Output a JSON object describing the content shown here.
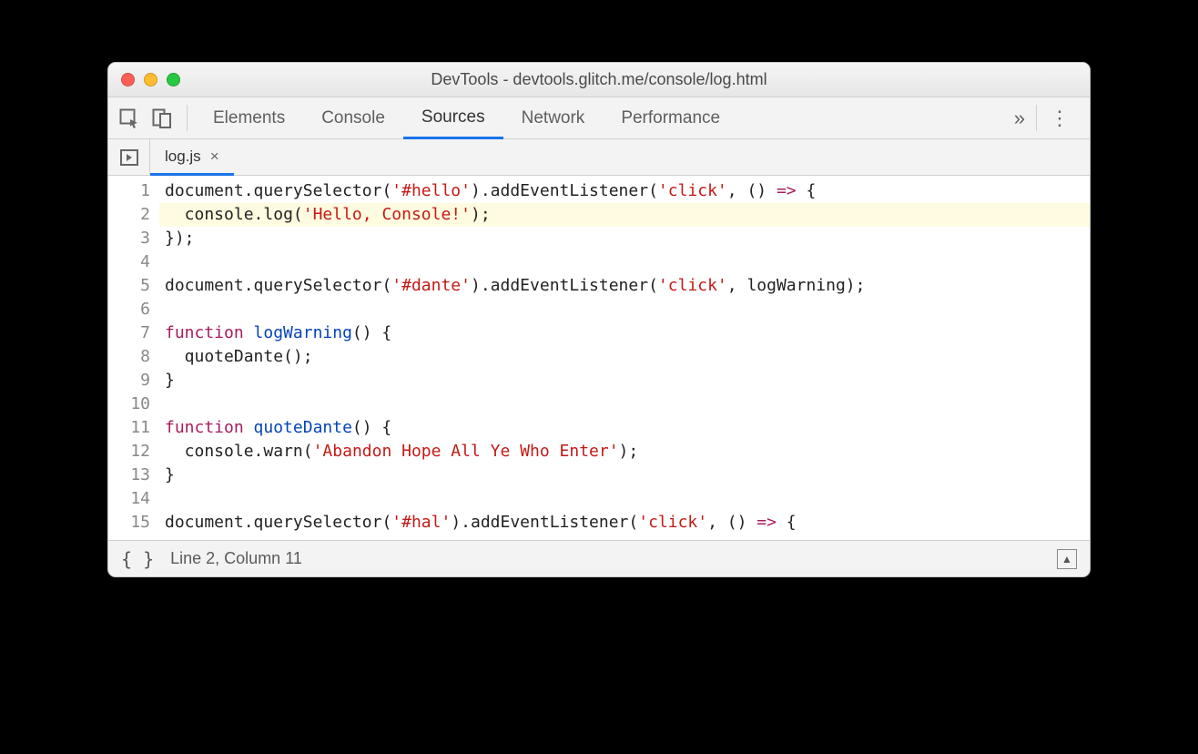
{
  "window": {
    "title": "DevTools - devtools.glitch.me/console/log.html"
  },
  "mainTabs": {
    "items": [
      {
        "label": "Elements",
        "active": false
      },
      {
        "label": "Console",
        "active": false
      },
      {
        "label": "Sources",
        "active": true
      },
      {
        "label": "Network",
        "active": false
      },
      {
        "label": "Performance",
        "active": false
      }
    ],
    "expand_glyph": "»"
  },
  "fileTabs": {
    "items": [
      {
        "label": "log.js",
        "close_glyph": "×"
      }
    ]
  },
  "code": {
    "lines": [
      {
        "n": 1,
        "hl": false,
        "segs": [
          [
            "d",
            "document"
          ],
          [
            "op",
            "."
          ],
          [
            "d",
            "querySelector"
          ],
          [
            "op",
            "("
          ],
          [
            "s",
            "'#hello'"
          ],
          [
            "op",
            ")."
          ],
          [
            "d",
            "addEventListener"
          ],
          [
            "op",
            "("
          ],
          [
            "s",
            "'click'"
          ],
          [
            "op",
            ", () "
          ],
          [
            "k",
            "=>"
          ],
          [
            "op",
            " {"
          ]
        ]
      },
      {
        "n": 2,
        "hl": true,
        "segs": [
          [
            "op",
            "  console"
          ],
          [
            "op",
            "."
          ],
          [
            "d",
            "log"
          ],
          [
            "op",
            "("
          ],
          [
            "s",
            "'Hello, Console!'"
          ],
          [
            "op",
            ");"
          ]
        ]
      },
      {
        "n": 3,
        "hl": false,
        "segs": [
          [
            "op",
            "});"
          ]
        ]
      },
      {
        "n": 4,
        "hl": false,
        "segs": []
      },
      {
        "n": 5,
        "hl": false,
        "segs": [
          [
            "d",
            "document"
          ],
          [
            "op",
            "."
          ],
          [
            "d",
            "querySelector"
          ],
          [
            "op",
            "("
          ],
          [
            "s",
            "'#dante'"
          ],
          [
            "op",
            ")."
          ],
          [
            "d",
            "addEventListener"
          ],
          [
            "op",
            "("
          ],
          [
            "s",
            "'click'"
          ],
          [
            "op",
            ", logWarning);"
          ]
        ]
      },
      {
        "n": 6,
        "hl": false,
        "segs": []
      },
      {
        "n": 7,
        "hl": false,
        "segs": [
          [
            "k",
            "function "
          ],
          [
            "fn",
            "logWarning"
          ],
          [
            "op",
            "() {"
          ]
        ]
      },
      {
        "n": 8,
        "hl": false,
        "segs": [
          [
            "op",
            "  quoteDante();"
          ]
        ]
      },
      {
        "n": 9,
        "hl": false,
        "segs": [
          [
            "op",
            "}"
          ]
        ]
      },
      {
        "n": 10,
        "hl": false,
        "segs": []
      },
      {
        "n": 11,
        "hl": false,
        "segs": [
          [
            "k",
            "function "
          ],
          [
            "fn",
            "quoteDante"
          ],
          [
            "op",
            "() {"
          ]
        ]
      },
      {
        "n": 12,
        "hl": false,
        "segs": [
          [
            "op",
            "  console"
          ],
          [
            "op",
            "."
          ],
          [
            "d",
            "warn"
          ],
          [
            "op",
            "("
          ],
          [
            "s",
            "'Abandon Hope All Ye Who Enter'"
          ],
          [
            "op",
            ");"
          ]
        ]
      },
      {
        "n": 13,
        "hl": false,
        "segs": [
          [
            "op",
            "}"
          ]
        ]
      },
      {
        "n": 14,
        "hl": false,
        "segs": []
      },
      {
        "n": 15,
        "hl": false,
        "segs": [
          [
            "d",
            "document"
          ],
          [
            "op",
            "."
          ],
          [
            "d",
            "querySelector"
          ],
          [
            "op",
            "("
          ],
          [
            "s",
            "'#hal'"
          ],
          [
            "op",
            ")."
          ],
          [
            "d",
            "addEventListener"
          ],
          [
            "op",
            "("
          ],
          [
            "s",
            "'click'"
          ],
          [
            "op",
            ", () "
          ],
          [
            "k",
            "=>"
          ],
          [
            "op",
            " {"
          ]
        ]
      }
    ]
  },
  "status": {
    "cursor": "Line 2, Column 11"
  }
}
